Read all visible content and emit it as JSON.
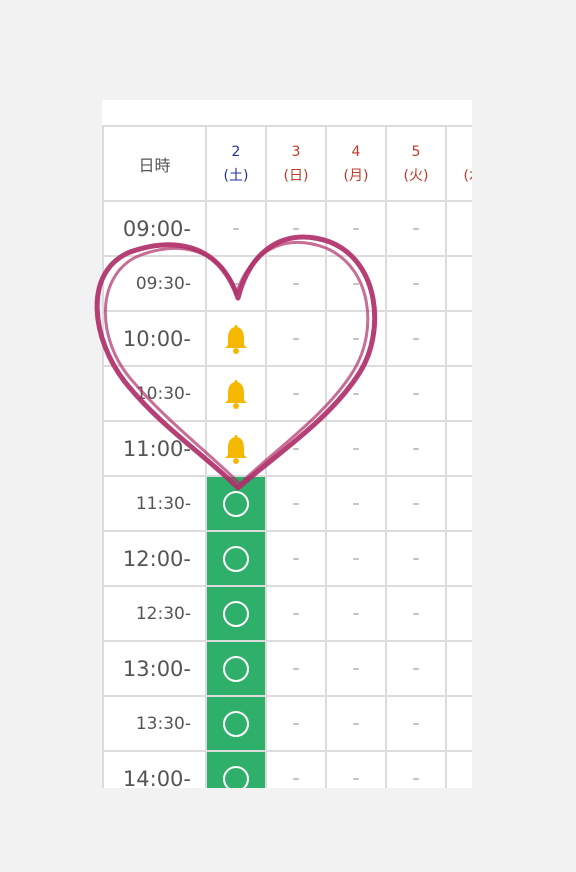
{
  "header": {
    "label": "日時",
    "days": [
      {
        "num": "2",
        "dow": "(土)",
        "color": "blue"
      },
      {
        "num": "3",
        "dow": "(日)",
        "color": "red"
      },
      {
        "num": "4",
        "dow": "(月)",
        "color": "red"
      },
      {
        "num": "5",
        "dow": "(火)",
        "color": "red"
      },
      {
        "num": "6",
        "dow": "(水)",
        "color": "red"
      }
    ]
  },
  "slots": [
    {
      "time": "09:00-",
      "day2": "dash"
    },
    {
      "time": "09:30-",
      "day2": "dash"
    },
    {
      "time": "10:00-",
      "day2": "bell"
    },
    {
      "time": "10:30-",
      "day2": "bell"
    },
    {
      "time": "11:00-",
      "day2": "bell"
    },
    {
      "time": "11:30-",
      "day2": "available"
    },
    {
      "time": "12:00-",
      "day2": "available"
    },
    {
      "time": "12:30-",
      "day2": "available"
    },
    {
      "time": "13:00-",
      "day2": "available"
    },
    {
      "time": "13:30-",
      "day2": "available"
    },
    {
      "time": "14:00-",
      "day2": "available"
    }
  ],
  "dash": "–",
  "colors": {
    "available": "#2fb06a",
    "bell": "#f5b800",
    "heart": "#b0306a",
    "saturday": "#223399",
    "weekday": "#c0392b"
  }
}
